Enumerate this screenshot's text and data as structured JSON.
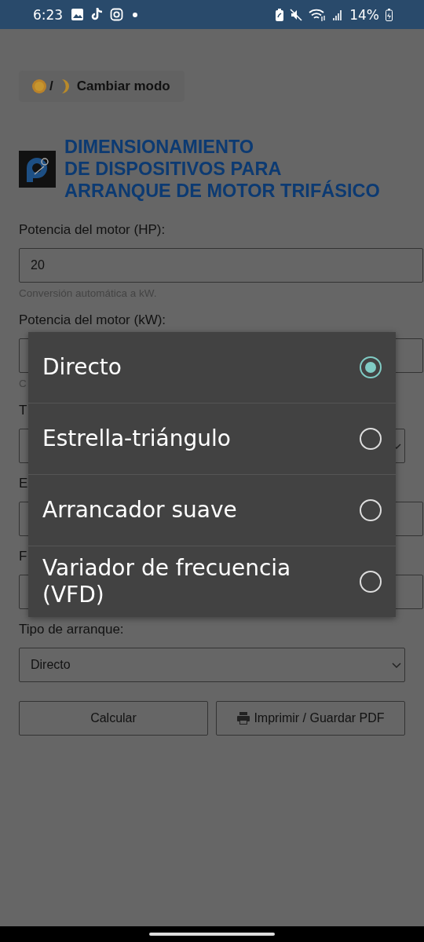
{
  "status_bar": {
    "time": "6:23",
    "battery": "14%"
  },
  "mode_button": {
    "separator": "/",
    "label": "Cambiar modo"
  },
  "title_lines": [
    "DIMENSIONAMIENTO",
    "DE DISPOSITIVOS PARA",
    "ARRANQUE DE MOTOR TRIFÁSICO"
  ],
  "form": [
    {
      "kind": "label",
      "text": "Potencia del motor (HP):"
    },
    {
      "kind": "input",
      "value": "20"
    },
    {
      "kind": "hint",
      "text": "Conversión automática a kW."
    },
    {
      "kind": "label",
      "text": "Potencia del motor (kW):"
    },
    {
      "kind": "input"
    },
    {
      "kind": "hint",
      "text": "C"
    },
    {
      "kind": "label",
      "text": "T"
    },
    {
      "kind": "select"
    },
    {
      "kind": "label",
      "text": "E"
    },
    {
      "kind": "input"
    },
    {
      "kind": "label",
      "text": "F"
    },
    {
      "kind": "input"
    },
    {
      "kind": "label",
      "text": "Tipo de arranque:"
    },
    {
      "kind": "select",
      "value": "Directo"
    }
  ],
  "buttons": [
    {
      "kind": "plain",
      "label": "Calcular"
    },
    {
      "kind": "print",
      "label": "Imprimir / Guardar PDF"
    }
  ],
  "picker": {
    "options": [
      {
        "label": "Directo",
        "selected": true
      },
      {
        "label": "Estrella-triángulo",
        "selected": false
      },
      {
        "label": "Arrancador suave",
        "selected": false
      },
      {
        "label": "Variador de frecuencia (VFD)",
        "selected": false
      }
    ]
  }
}
